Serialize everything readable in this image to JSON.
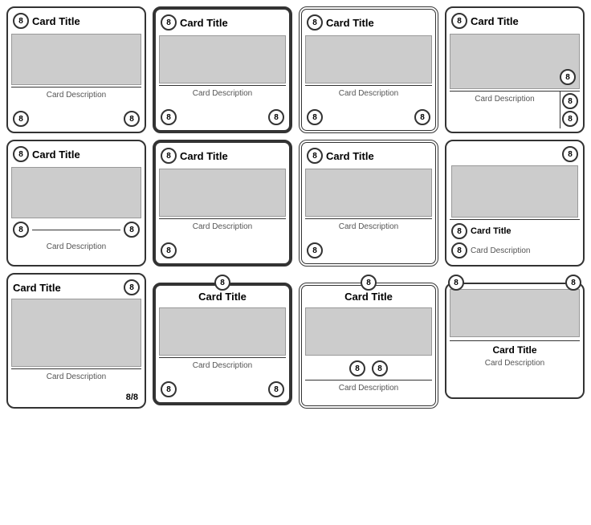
{
  "cards": [
    {
      "id": "card-1-1",
      "title": "Card Title",
      "description": "Card Description",
      "badge_tl": "8",
      "badge_bl": "8",
      "badge_br": "8",
      "layout": "standard"
    },
    {
      "id": "card-1-2",
      "title": "Card Title",
      "description": "Card Description",
      "badge_tl": "8",
      "badge_bl": "8",
      "badge_br": "8",
      "layout": "standard-thick"
    },
    {
      "id": "card-1-3",
      "title": "Card Title",
      "description": "Card Description",
      "badge_tl": "8",
      "badge_bl": "8",
      "badge_br": "8",
      "layout": "standard-thick2"
    },
    {
      "id": "card-1-4",
      "title": "Card Title",
      "description": "Card Description",
      "badge_tl": "8",
      "badge_inner": "8",
      "badge_stack1": "8",
      "badge_stack2": "8",
      "layout": "badge-inner-right"
    },
    {
      "id": "card-2-1",
      "title": "Card Title",
      "description": "Card Description",
      "badge_tl": "8",
      "badge_ml": "8",
      "badge_mr": "8",
      "layout": "mid-divider"
    },
    {
      "id": "card-2-2",
      "title": "Card Title",
      "description": "Card Description",
      "badge_tl": "8",
      "badge_bl": "8",
      "layout": "tall-left-badge"
    },
    {
      "id": "card-2-3",
      "title": "Card Title",
      "description": "Card Description",
      "badge_tl": "8",
      "badge_bl": "8",
      "layout": "thick-left-badge"
    },
    {
      "id": "card-2-4",
      "title": "Card Title",
      "description": "Card Description",
      "badge_tr": "8",
      "badge_ml": "8",
      "badge_bl": "8",
      "layout": "right-col"
    },
    {
      "id": "card-3-1",
      "title": "Card Title",
      "description": "Card Description",
      "badge_tr": "8",
      "footer_text": "8/8",
      "layout": "bottom-right-score"
    },
    {
      "id": "card-3-2",
      "title": "Card Title",
      "description": "Card Description",
      "badge_tc": "8",
      "badge_bl": "8",
      "badge_br": "8",
      "layout": "top-center-badge"
    },
    {
      "id": "card-3-3",
      "title": "Card Title",
      "description": "Card Description",
      "badge_tc": "8",
      "badge_bl": "8",
      "badge_br": "8",
      "layout": "top-center-thick"
    },
    {
      "id": "card-3-4",
      "title": "Card Title",
      "description": "Card Description",
      "badge_tl": "8",
      "badge_tr": "8",
      "layout": "wide-bottom"
    }
  ],
  "labels": {
    "card_title": "Card Title",
    "card_desc": "Card Description",
    "badge_val": "8",
    "score": "8/8"
  }
}
